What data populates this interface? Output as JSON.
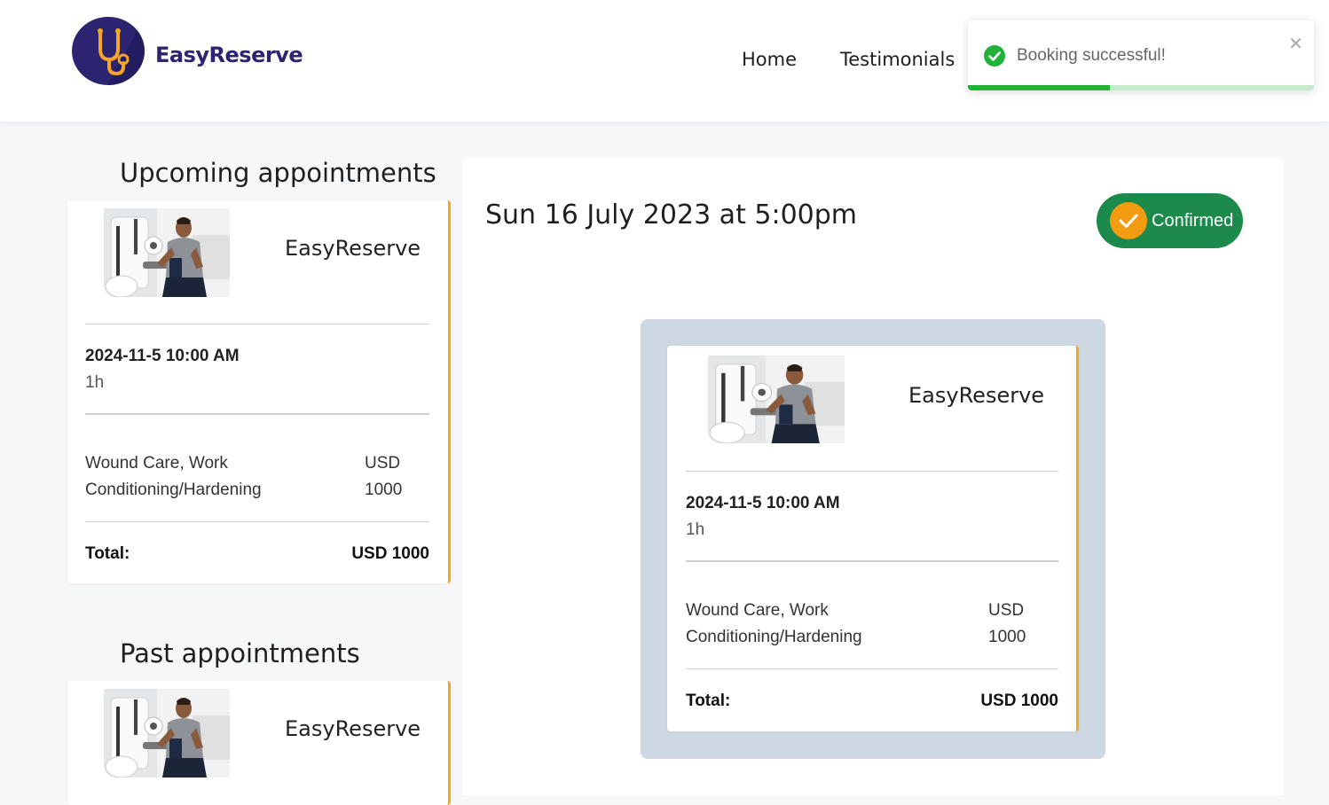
{
  "app": {
    "name": "EasyReserve",
    "logo_icon": "stethoscope-icon",
    "brand_color": "#2c2470"
  },
  "nav": {
    "home": "Home",
    "testimonials": "Testimonials"
  },
  "toast": {
    "message": "Booking successful!",
    "icon": "check-circle-icon",
    "close_icon": "close-icon",
    "progress": 0.41,
    "color": "#22b23a"
  },
  "upcoming": {
    "title": "Upcoming appointments",
    "card": {
      "brand": "EasyReserve",
      "datetime": "2024-11-5 10:00 AM",
      "duration": "1h",
      "service": "Wound Care, Work Conditioning/Hardening",
      "price": "USD 1000",
      "total_label": "Total:",
      "total_value": "USD 1000"
    }
  },
  "past": {
    "title": "Past appointments",
    "card": {
      "brand": "EasyReserve"
    }
  },
  "detail": {
    "date": "Sun 16 July 2023 at 5:00pm",
    "status": "Confirmed",
    "status_color": "#1b8a4b",
    "card": {
      "brand": "EasyReserve",
      "datetime": "2024-11-5 10:00 AM",
      "duration": "1h",
      "service": "Wound Care, Work Conditioning/Hardening",
      "price": "USD 1000",
      "total_label": "Total:",
      "total_value": "USD 1000"
    }
  },
  "accent_color": "#f5a623"
}
